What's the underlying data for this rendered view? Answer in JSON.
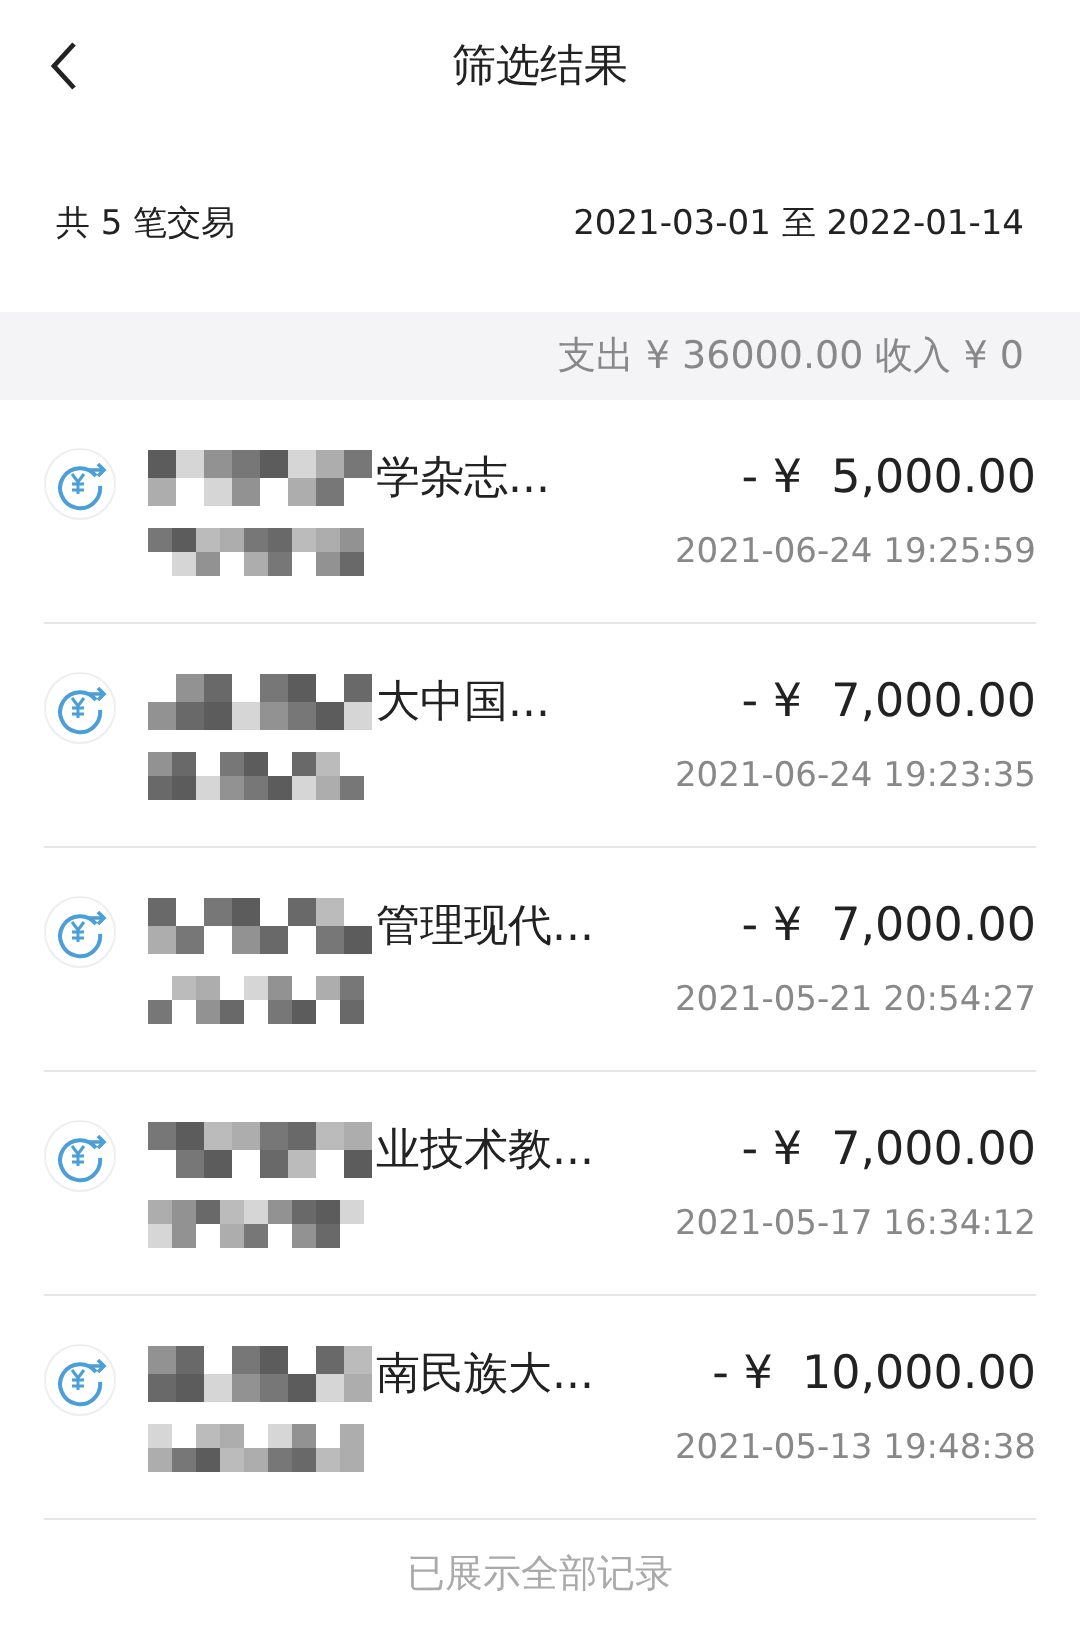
{
  "header": {
    "title": "筛选结果"
  },
  "summary": {
    "count": "共 5 笔交易",
    "range": "2021-03-01 至 2022-01-14"
  },
  "totals": "支出 ¥ 36000.00 收入 ¥ 0",
  "transactions": [
    {
      "title": "学杂志...",
      "redacted": true,
      "amount": "- ¥  5,000.00",
      "time": "2021-06-24 19:25:59"
    },
    {
      "title": "大中国...",
      "redacted": true,
      "amount": "- ¥  7,000.00",
      "time": "2021-06-24 19:23:35"
    },
    {
      "title": "管理现代...",
      "redacted": true,
      "amount": "- ¥  7,000.00",
      "time": "2021-05-21 20:54:27"
    },
    {
      "title": "业技术教...",
      "redacted": true,
      "amount": "- ¥  7,000.00",
      "time": "2021-05-17 16:34:12"
    },
    {
      "title": "南民族大...",
      "redacted": true,
      "amount": "- ¥  10,000.00",
      "time": "2021-05-13 19:48:38"
    }
  ],
  "footer": "已展示全部记录"
}
